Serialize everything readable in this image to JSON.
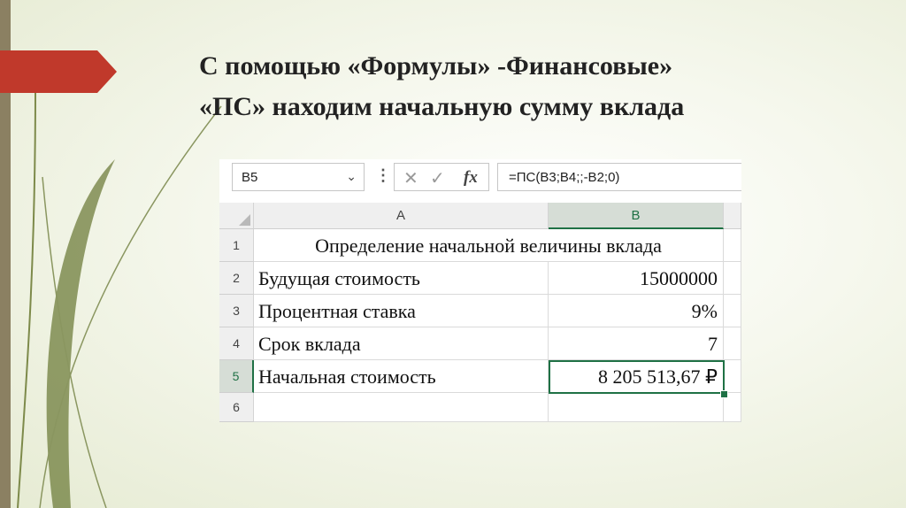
{
  "slide": {
    "title_line1": "С помощью «Формулы» -Финансовые»",
    "title_line2": "«ПС» находим начальную сумму вклада"
  },
  "colors": {
    "accent_arrow": "#c0392b",
    "left_bar": "#8b8062",
    "excel_green": "#1f7145"
  },
  "excel": {
    "name_box": "B5",
    "formula": "=ПС(B3;B4;;-B2;0)",
    "fx_label": "fx",
    "icons": [
      "chevron-down-icon",
      "more-icon",
      "cancel-icon",
      "enter-icon",
      "function-icon"
    ],
    "columns": [
      "A",
      "B"
    ],
    "rows": [
      {
        "num": "1",
        "a": "Определение начальной величины вклада",
        "b": ""
      },
      {
        "num": "2",
        "a": "Будущая стоимость",
        "b": "15000000"
      },
      {
        "num": "3",
        "a": "Процентная ставка",
        "b": "9%"
      },
      {
        "num": "4",
        "a": "Срок вклада",
        "b": "7"
      },
      {
        "num": "5",
        "a": "Начальная стоимость",
        "b": "8 205 513,67 ₽"
      },
      {
        "num": "6",
        "a": "",
        "b": ""
      }
    ]
  }
}
